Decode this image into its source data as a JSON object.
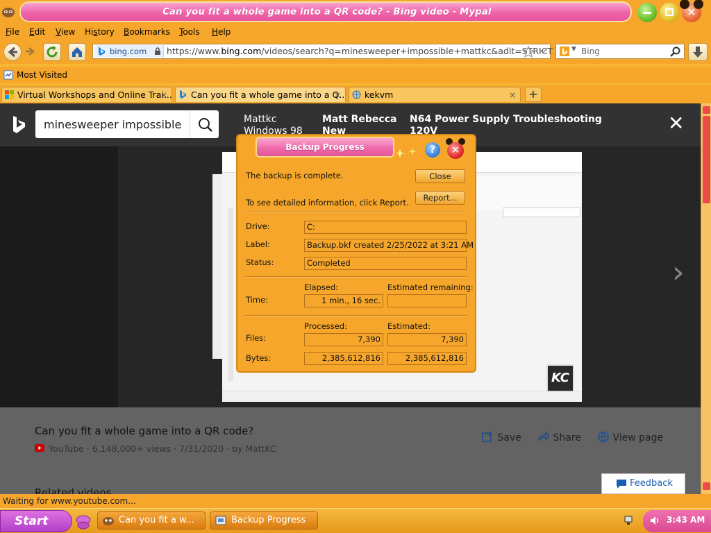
{
  "window": {
    "title": "Can you fit a whole game into a QR code? - Bing video - Mypal"
  },
  "menu": {
    "items": [
      {
        "label": "File",
        "accel": "F"
      },
      {
        "label": "Edit",
        "accel": "E"
      },
      {
        "label": "View",
        "accel": "V"
      },
      {
        "label": "History",
        "accel": "s"
      },
      {
        "label": "Bookmarks",
        "accel": "B"
      },
      {
        "label": "Tools",
        "accel": "T"
      },
      {
        "label": "Help",
        "accel": "H"
      }
    ]
  },
  "nav": {
    "site": "bing.com",
    "url_prefix": "https://www.",
    "url_domain": "bing.com",
    "url_rest": "/videos/search?q=minesweeper+impossible+mattkc&adlt=STRICT",
    "search_placeholder": "Bing"
  },
  "bookmarks": {
    "most_visited": "Most Visited"
  },
  "tabs": [
    {
      "label": "Virtual Workshops and Online Trai...",
      "close": "×"
    },
    {
      "label": "Can you fit a whole game into a Q...",
      "close": "×"
    },
    {
      "label": "kekvm",
      "close": "×"
    }
  ],
  "new_tab": "+",
  "bing": {
    "query": "minesweeper impossible",
    "more": "...",
    "related": [
      {
        "line1": "Mattkc",
        "line2": "Windows 98",
        "bold": false
      },
      {
        "line1": "Matt Rebecca",
        "line2": "New",
        "bold": true
      },
      {
        "line1": "N64 Power Supply Troubleshooting",
        "line2": "120V",
        "bold": true
      }
    ],
    "close": "✕",
    "next": "›",
    "video_title": "Can you fit a whole game into a QR code?",
    "video_meta": "YouTube · 6,148,000+ views · 7/31/2020 · by MattKC",
    "actions": {
      "save": "Save",
      "share": "Share",
      "view_page": "View page"
    },
    "related_videos": "Related videos",
    "feedback": "Feedback",
    "logo_text": "KC"
  },
  "dialog": {
    "title": "Backup Progress",
    "help": "?",
    "close_x": "✕",
    "message": "The backup is complete.",
    "report_hint": "To see detailed information, click Report.",
    "close_button": "Close",
    "report_button": "Report...",
    "drive_label": "Drive:",
    "drive_value": "C:",
    "label_label": "Label:",
    "label_value": "Backup.bkf created 2/25/2022 at 3:21 AM",
    "status_label": "Status:",
    "status_value": "Completed",
    "time_label": "Time:",
    "elapsed_header": "Elapsed:",
    "elapsed_value": "1 min., 16 sec.",
    "remaining_header": "Estimated remaining:",
    "remaining_value": "",
    "processed_header": "Processed:",
    "estimated_header": "Estimated:",
    "files_label": "Files:",
    "files_processed": "7,390",
    "files_estimated": "7,390",
    "bytes_label": "Bytes:",
    "bytes_processed": "2,385,612,816",
    "bytes_estimated": "2,385,612,816"
  },
  "status_bar": {
    "text": "Waiting for www.youtube.com..."
  },
  "taskbar": {
    "start": "Start",
    "items": [
      {
        "label": "Can you fit a w..."
      },
      {
        "label": "Backup Progress"
      }
    ],
    "clock": "3:43 AM"
  },
  "colors": {
    "chrome_orange": "#f6a62a",
    "title_pink": "#ef65a9",
    "start_purple": "#b13fc9"
  }
}
